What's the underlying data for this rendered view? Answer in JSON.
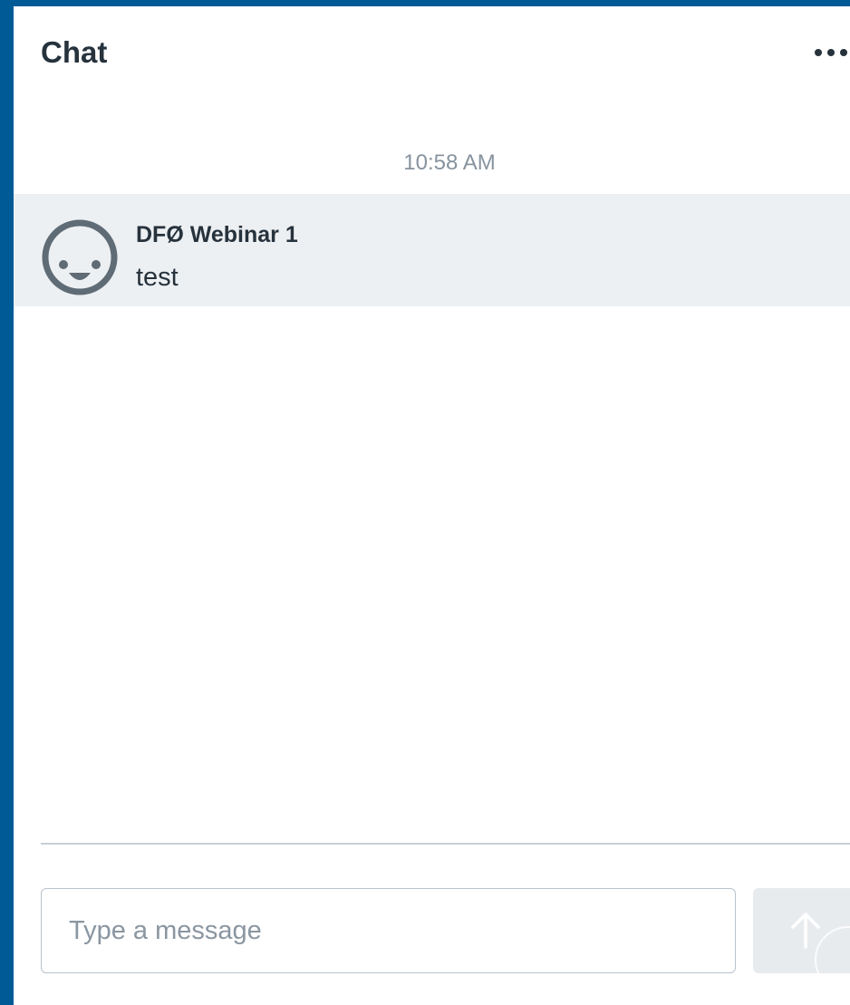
{
  "chat": {
    "title": "Chat",
    "more_icon": "more-horizontal-icon",
    "timestamp": "10:58 AM",
    "messages": [
      {
        "sender": "DFØ Webinar 1",
        "text": "test",
        "avatar_icon": "default-avatar-icon"
      }
    ],
    "input": {
      "placeholder": "Type a message",
      "value": ""
    },
    "send_icon": "arrow-up-icon"
  },
  "colors": {
    "frame": "#005a96",
    "message_highlight": "#edf0f2",
    "text": "#26323c",
    "muted_text": "#87939e",
    "send_button_bg": "#e8ebee"
  }
}
